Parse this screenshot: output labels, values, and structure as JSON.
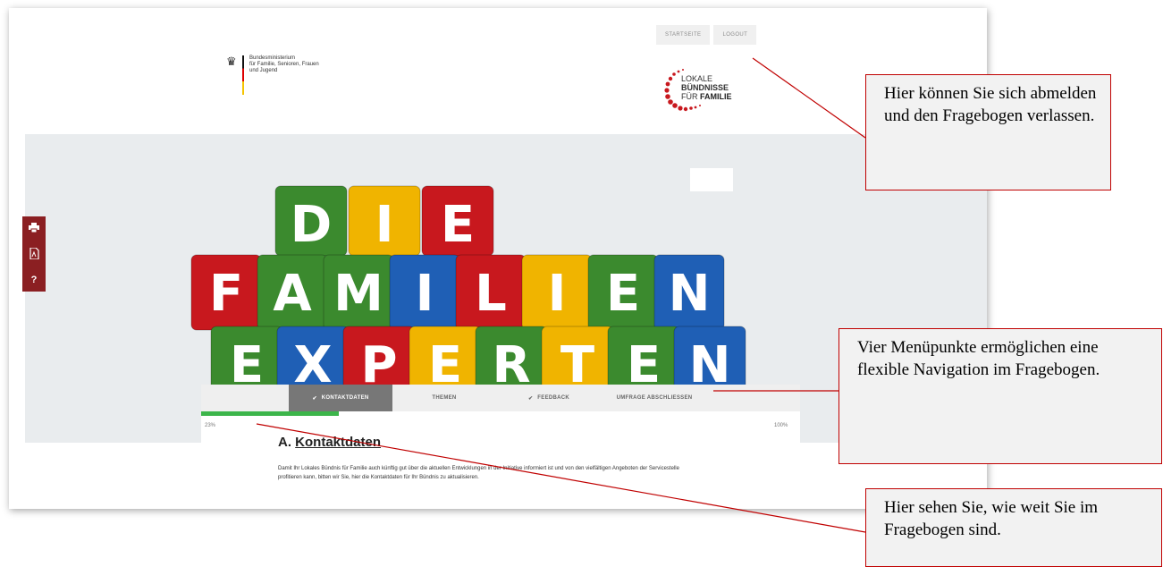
{
  "topnav": {
    "startseite": "STARTSEITE",
    "logout": "LOGOUT"
  },
  "ministry": {
    "line1": "Bundesministerium",
    "line2": "für Familie, Senioren, Frauen",
    "line3": "und Jugend"
  },
  "logo": {
    "line1": "LOKALE",
    "line2": "BÜNDNISSE",
    "line3a": "FÜR ",
    "line3b": "FAMILIE"
  },
  "hero": {
    "rows": [
      {
        "letters": [
          "D",
          "I",
          "E"
        ],
        "colors": [
          "#3b8a2e",
          "#f0b400",
          "#c8181e"
        ]
      },
      {
        "letters": [
          "F",
          "A",
          "M",
          "I",
          "L",
          "I",
          "E",
          "N"
        ],
        "colors": [
          "#c8181e",
          "#3b8a2e",
          "#3b8a2e",
          "#1f5fb5",
          "#c8181e",
          "#f0b400",
          "#3b8a2e",
          "#1f5fb5"
        ]
      },
      {
        "letters": [
          "E",
          "X",
          "P",
          "E",
          "R",
          "T",
          "E",
          "N"
        ],
        "colors": [
          "#3b8a2e",
          "#1f5fb5",
          "#c8181e",
          "#f0b400",
          "#3b8a2e",
          "#f0b400",
          "#3b8a2e",
          "#1f5fb5"
        ]
      }
    ]
  },
  "sidebar": {
    "print_icon": "printer-icon",
    "pdf_icon": "pdf-icon",
    "help": "?"
  },
  "tabs": [
    {
      "label": "KONTAKTDATEN",
      "check": true
    },
    {
      "label": "THEMEN",
      "check": false
    },
    {
      "label": "FEEDBACK",
      "check": true
    },
    {
      "label": "UMFRAGE ABSCHLIESSEN",
      "check": false
    }
  ],
  "progress": {
    "value": 0.23,
    "left_label": "23%",
    "right_label": "100%"
  },
  "section": {
    "prefix": "A. ",
    "title": "Kontaktdaten",
    "text": "Damit Ihr Lokales Bündnis für Familie auch künftig gut über die aktuellen Entwicklungen in der Initiative informiert ist und von den vielfältigen Angeboten der Servicestelle profitieren kann, bitten wir Sie, hier die Kontaktdaten für Ihr Bündnis zu aktualisieren."
  },
  "callouts": {
    "logout": "Hier können Sie sich abmelden und den Fragebogen verlassen.",
    "menu": "Vier Menüpunkte ermöglichen eine flexible Navigation im Fragebogen.",
    "progress": "Hier sehen Sie, wie weit Sie im Fragebogen sind."
  },
  "colors": {
    "accent_red": "#c00000",
    "sidebar": "#8b1f22",
    "progress_green": "#3cb54a"
  }
}
